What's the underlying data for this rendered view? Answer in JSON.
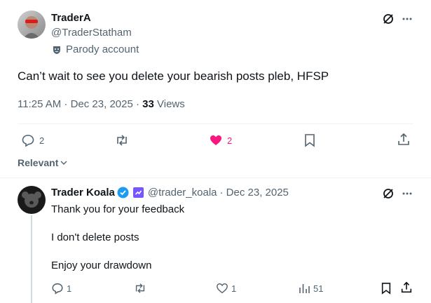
{
  "main_post": {
    "author_name": "TraderA",
    "author_handle": "@TraderStatham",
    "badge_text": "Parody account",
    "text": "Can’t wait to see you delete your bearish posts pleb, HFSP",
    "time": "11:25 AM · Dec 23, 2025 · ",
    "views_count": "33",
    "views_label": " Views",
    "replies": "2",
    "likes": "2"
  },
  "sort": {
    "label": "Relevant"
  },
  "reply": {
    "author_name": "Trader Koala",
    "author_handle": "@trader_koala",
    "date": "· Dec 23, 2025",
    "lines": [
      "Thank you for your feedback",
      "I don't delete posts",
      "Enjoy your drawdown"
    ],
    "replies": "1",
    "likes": "1",
    "views": "51"
  },
  "colors": {
    "like_active": "#f91880",
    "verified": "#1d9bf0",
    "affiliate": "#7856ff"
  }
}
